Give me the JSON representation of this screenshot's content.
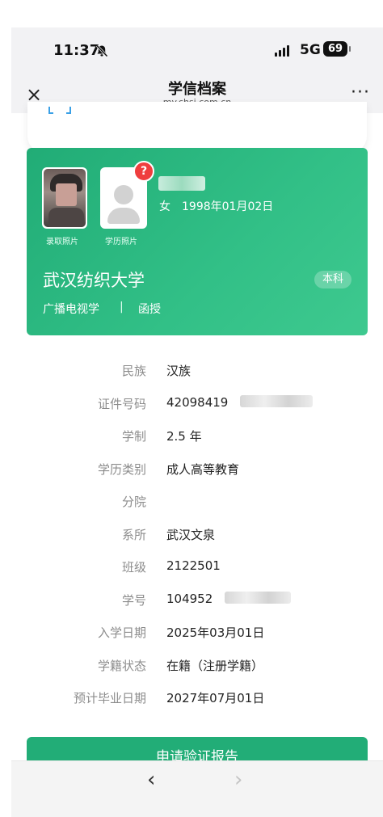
{
  "status_bar": {
    "time": "11:37",
    "network": "5G",
    "battery": "69"
  },
  "navbar": {
    "title": "学信档案",
    "subtitle": "my.chsi.com.cn",
    "close": "×",
    "more": "···"
  },
  "card": {
    "photo1_label": "录取照片",
    "photo2_label": "学历照片",
    "badge": "?",
    "gender": "女",
    "dob": "1998年01月02日",
    "school": "武汉纺织大学",
    "degree": "本科",
    "major": "广播电视学",
    "separator": "|",
    "mode": "函授"
  },
  "info": [
    {
      "label": "民族",
      "value": "汉族"
    },
    {
      "label": "证件号码",
      "value": "42098419"
    },
    {
      "label": "学制",
      "value": "2.5 年"
    },
    {
      "label": "学历类别",
      "value": "成人高等教育"
    },
    {
      "label": "分院",
      "value": ""
    },
    {
      "label": "系所",
      "value": "武汉文泉"
    },
    {
      "label": "班级",
      "value": "2122501"
    },
    {
      "label": "学号",
      "value": "104952"
    },
    {
      "label": "入学日期",
      "value": "2025年03月01日"
    },
    {
      "label": "学籍状态",
      "value": "在籍（注册学籍）"
    },
    {
      "label": "预计毕业日期",
      "value": "2027年07月01日"
    }
  ],
  "apply_button": "申请验证报告",
  "bottom_nav": {
    "back": "‹",
    "forward": "›"
  },
  "colors": {
    "accent": "#22ad77",
    "badge": "#ef3e3e"
  }
}
